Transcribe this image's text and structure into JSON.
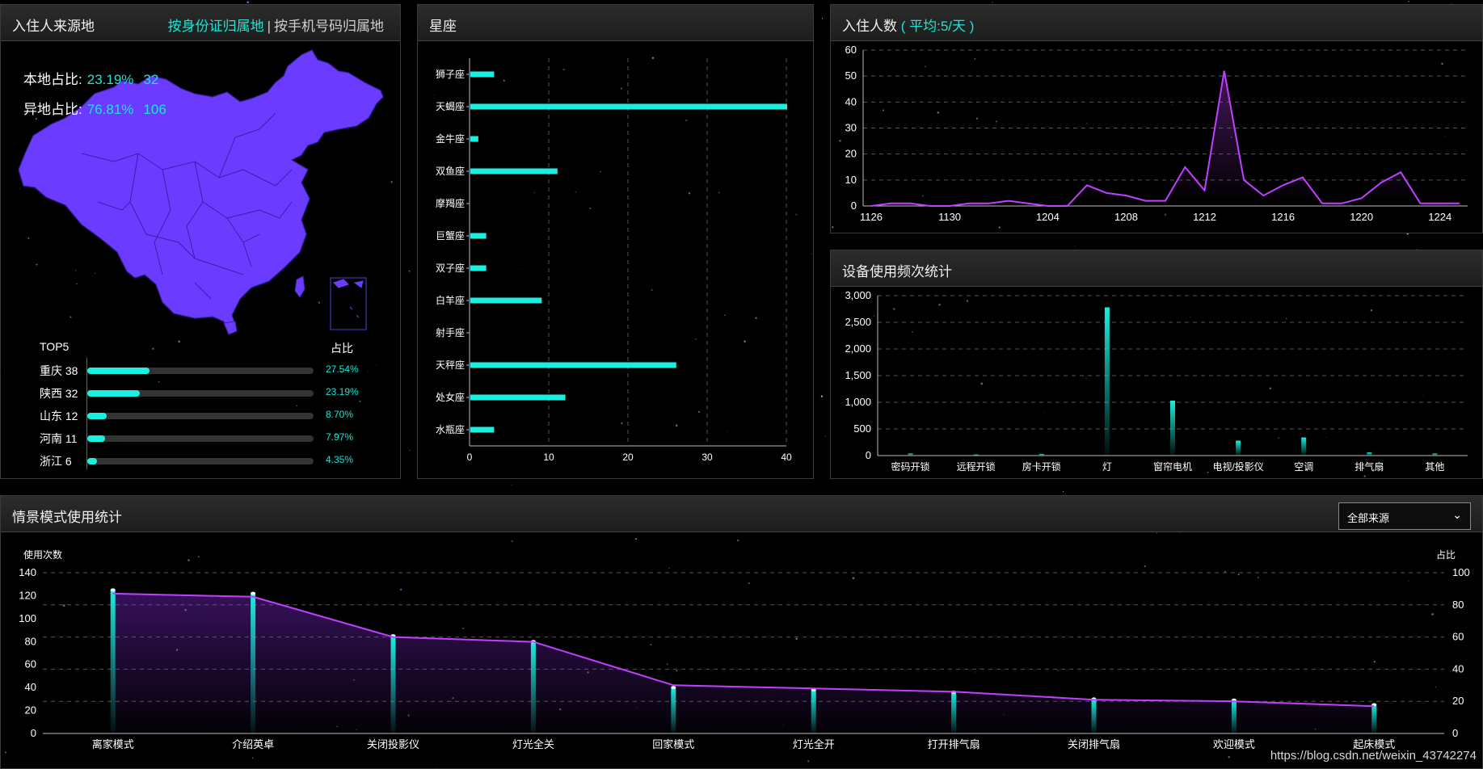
{
  "colors": {
    "accent": "#19e6d6",
    "map": "#6b3cff",
    "line": "#c040ff",
    "bar": "#19f0df"
  },
  "source_panel": {
    "title": "入住人来源地",
    "switch_active": "按身份证归属地",
    "switch_sep": "|",
    "switch_other": "按手机号码归属地",
    "local_label": "本地占比:",
    "local_pct": "23.19%",
    "local_count": "32",
    "remote_label": "异地占比:",
    "remote_pct": "76.81%",
    "remote_count": "106",
    "top_label": "TOP5",
    "ratio_label": "占比",
    "top5": [
      {
        "name": "重庆 38",
        "pct": "27.54%",
        "value": 27.54
      },
      {
        "name": "陕西 32",
        "pct": "23.19%",
        "value": 23.19
      },
      {
        "name": "山东 12",
        "pct": "8.70%",
        "value": 8.7
      },
      {
        "name": "河南 11",
        "pct": "7.97%",
        "value": 7.97
      },
      {
        "name": "浙江 6",
        "pct": "4.35%",
        "value": 4.35
      }
    ]
  },
  "zodiac_panel": {
    "title": "星座"
  },
  "checkin_panel": {
    "title": "入住人数",
    "avg": "( 平均:5/天 )"
  },
  "device_panel": {
    "title": "设备使用频次统计"
  },
  "scene_panel": {
    "title": "情景模式使用统计",
    "select_value": "全部来源"
  },
  "watermark": "https://blog.csdn.net/weixin_43742274",
  "chart_data": [
    {
      "type": "bar",
      "orientation": "horizontal",
      "categories": [
        "狮子座",
        "天蝎座",
        "金牛座",
        "双鱼座",
        "摩羯座",
        "巨蟹座",
        "双子座",
        "白羊座",
        "射手座",
        "天秤座",
        "处女座",
        "水瓶座"
      ],
      "values": [
        3,
        40,
        1,
        11,
        0,
        2,
        2,
        9,
        0,
        26,
        12,
        3
      ],
      "xlim": [
        0,
        40
      ],
      "xticks": [
        "0",
        "10",
        "20",
        "30",
        "40"
      ]
    },
    {
      "type": "line",
      "x": [
        1126,
        1127,
        1128,
        1129,
        1130,
        1131,
        1201,
        1202,
        1203,
        1204,
        1205,
        1206,
        1207,
        1208,
        1209,
        1210,
        1211,
        1212,
        1213,
        1214,
        1215,
        1216,
        1217,
        1218,
        1219,
        1220,
        1221,
        1222,
        1223,
        1224,
        1225
      ],
      "values": [
        0,
        1,
        1,
        0,
        0,
        1,
        1,
        2,
        1,
        0,
        0,
        8,
        5,
        4,
        2,
        2,
        15,
        6,
        52,
        10,
        4,
        8,
        11,
        1,
        1,
        3,
        9,
        13,
        1,
        1,
        1
      ],
      "xticks": [
        "1126",
        "1130",
        "1204",
        "1208",
        "1212",
        "1216",
        "1220",
        "1224"
      ],
      "ylim": [
        0,
        60
      ],
      "yticks": [
        "0",
        "10",
        "20",
        "30",
        "40",
        "50",
        "60"
      ]
    },
    {
      "type": "bar",
      "categories": [
        "密码开锁",
        "远程开锁",
        "房卡开锁",
        "灯",
        "窗帘电机",
        "电视/投影仪",
        "空调",
        "排气扇",
        "其他"
      ],
      "values": [
        40,
        20,
        30,
        2780,
        1030,
        280,
        340,
        60,
        40
      ],
      "ylim": [
        0,
        3000
      ],
      "yticks": [
        "0",
        "500",
        "1,000",
        "1,500",
        "2,000",
        "2,500",
        "3,000"
      ]
    },
    {
      "type": "bar",
      "categories": [
        "离家模式",
        "介绍英卓",
        "关闭投影仪",
        "灯光全关",
        "回家模式",
        "灯光全开",
        "打开排气扇",
        "关闭排气扇",
        "欢迎模式",
        "起床模式"
      ],
      "values": [
        125,
        122,
        85,
        80,
        40,
        38,
        36,
        30,
        29,
        25
      ],
      "ylabel": "使用次数",
      "ylim": [
        0,
        140
      ],
      "yticks": [
        "0",
        "20",
        "40",
        "60",
        "80",
        "100",
        "120",
        "140"
      ],
      "series": [
        {
          "name": "占比",
          "values": [
            87,
            85,
            60,
            57,
            30,
            28,
            26,
            21,
            20,
            17
          ]
        }
      ],
      "y2label": "占比",
      "y2lim": [
        0,
        100
      ],
      "y2ticks": [
        "0",
        "20",
        "40",
        "60",
        "80",
        "100"
      ]
    }
  ]
}
